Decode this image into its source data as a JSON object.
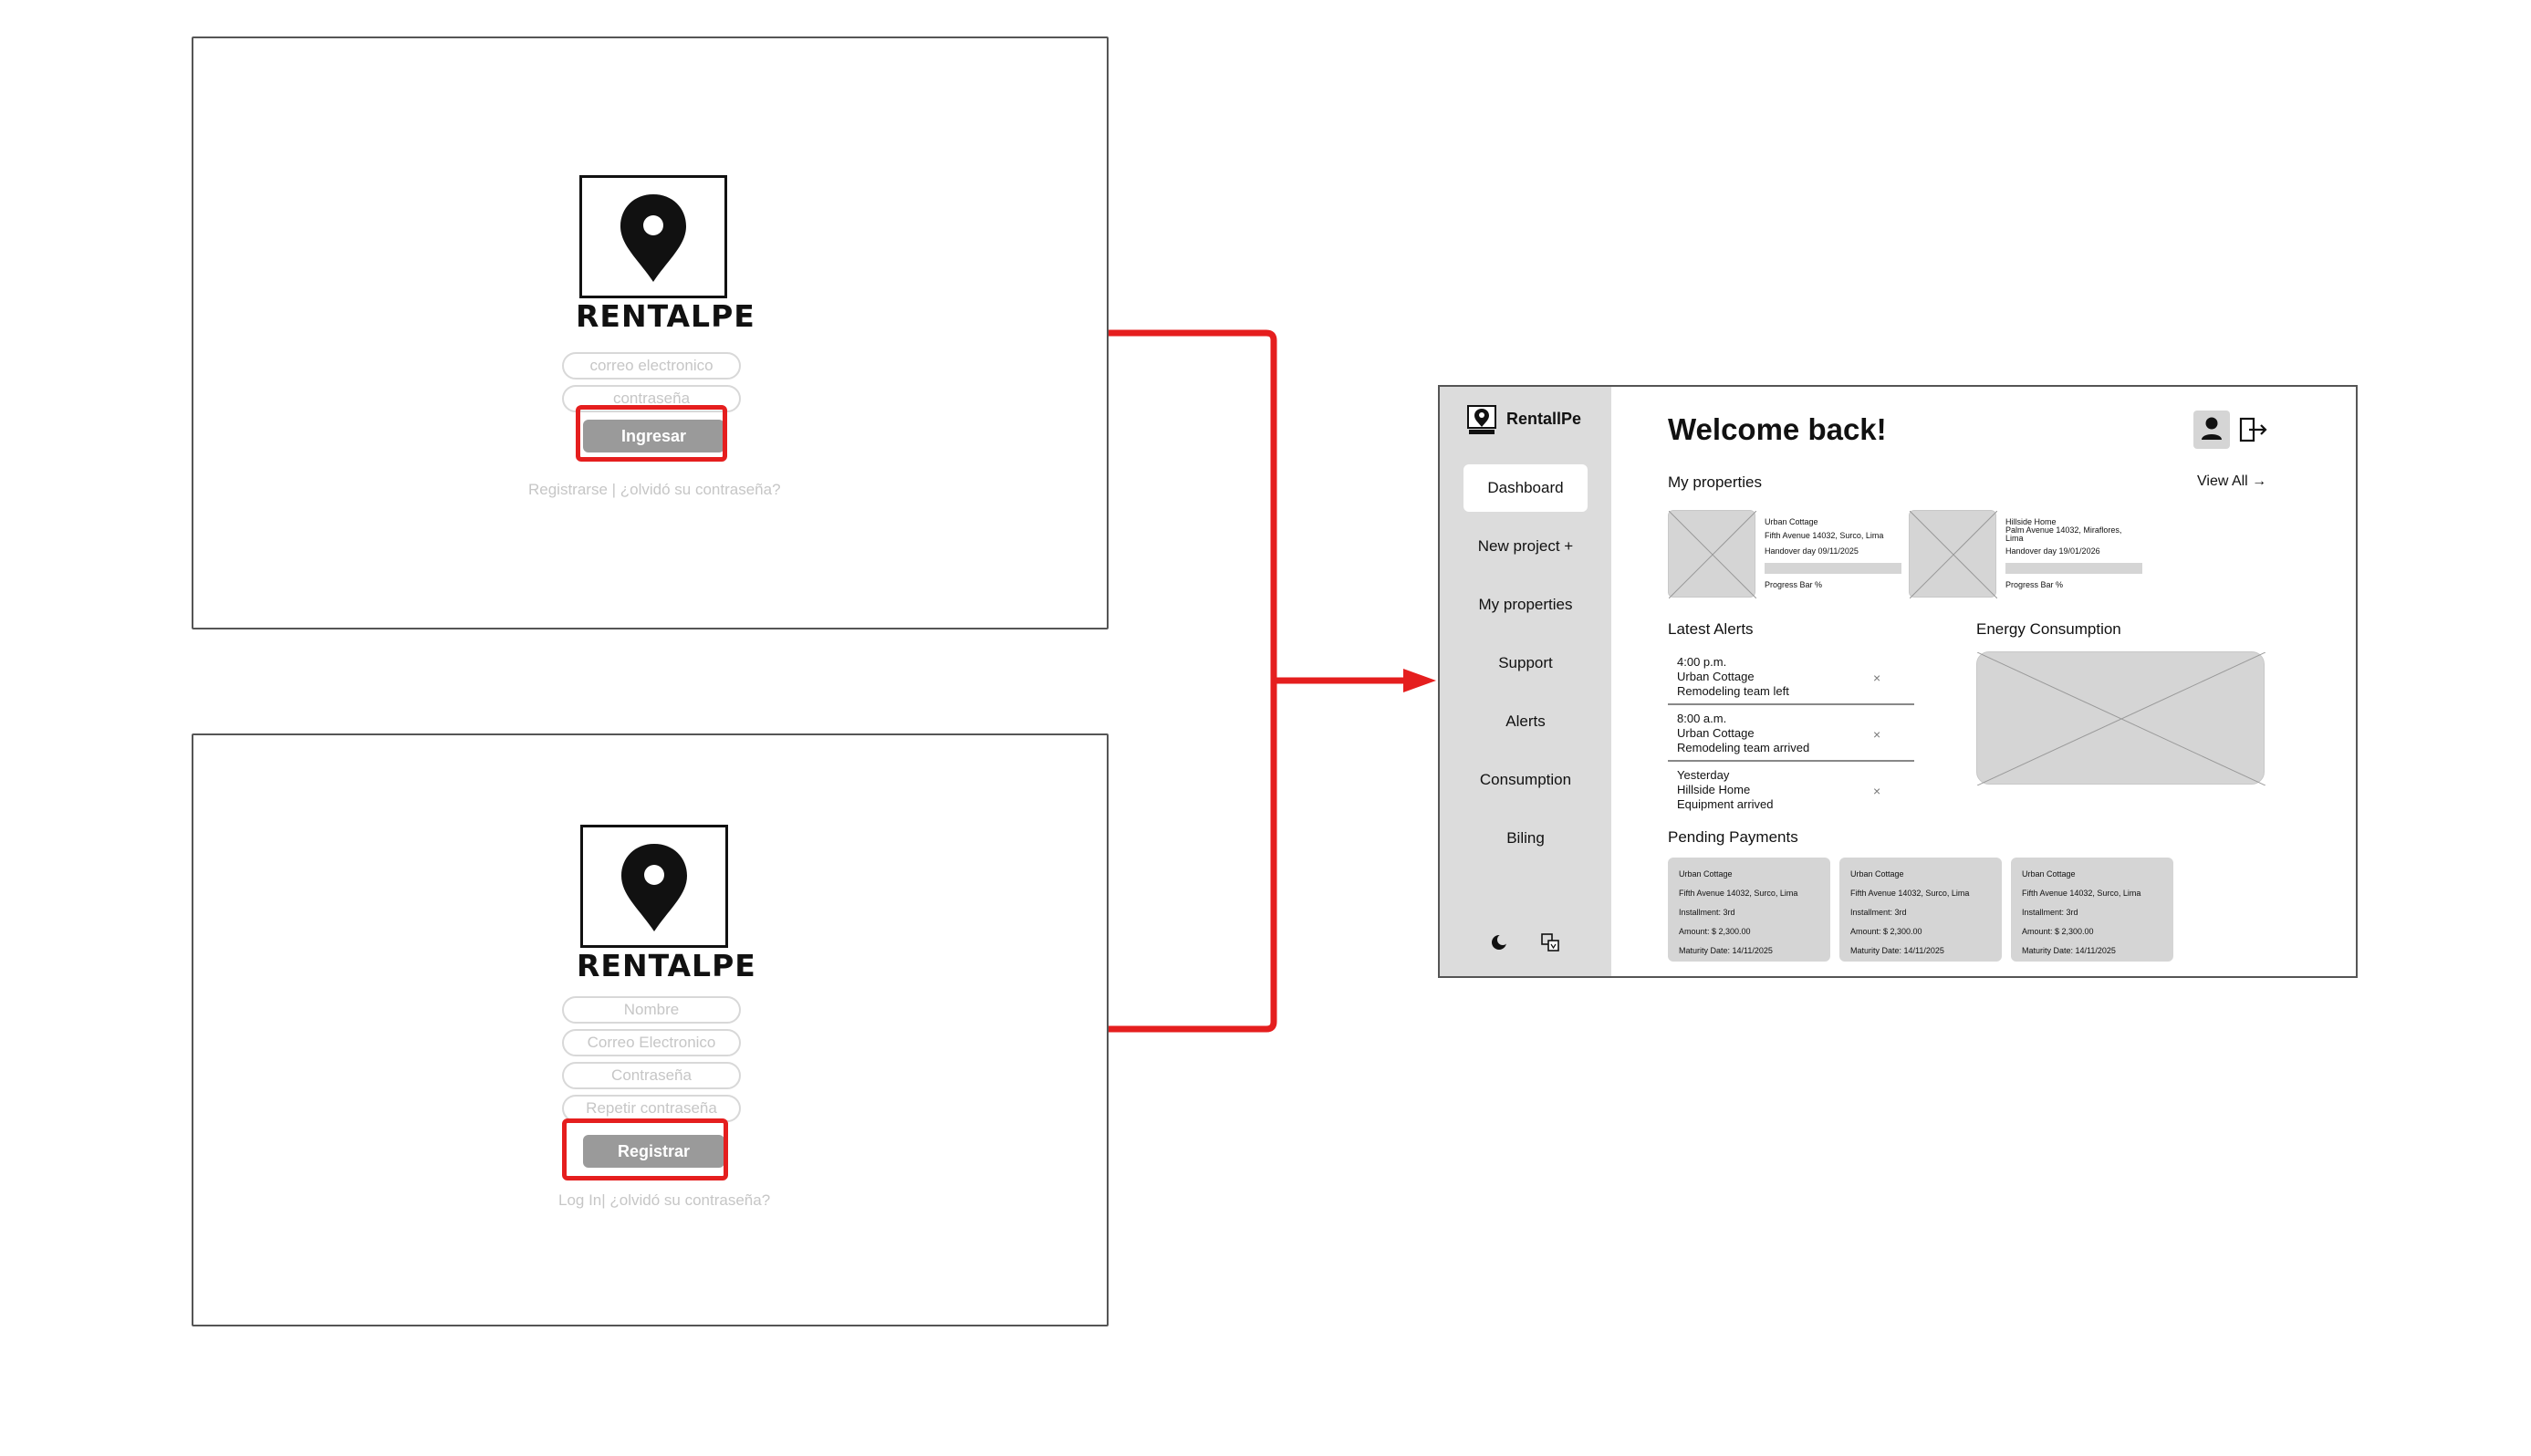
{
  "login": {
    "brand": "RENTALPE",
    "email_placeholder": "correo electronico",
    "password_placeholder": "contraseña",
    "submit_label": "Ingresar",
    "links": "Registrarse | ¿olvidó su contraseña?"
  },
  "register": {
    "brand": "RENTALPE",
    "name_placeholder": "Nombre",
    "email_placeholder": "Correo Electronico",
    "password_placeholder": "Contraseña",
    "repeat_password_placeholder": "Repetir contraseña",
    "submit_label": "Registrar",
    "links": "Log In| ¿olvidó su contraseña?"
  },
  "dashboard": {
    "brand": "RentallPe",
    "nav": [
      "Dashboard",
      "New project +",
      "My properties",
      "Support",
      "Alerts",
      "Consumption",
      "Biling"
    ],
    "active_nav": "Dashboard",
    "welcome": "Welcome back!",
    "my_properties_title": "My properties",
    "view_all": "View All →",
    "properties": [
      {
        "name": "Urban Cottage",
        "address": "Fifth Avenue 14032, Surco, Lima",
        "handover": "Handover day 09/11/2025",
        "progress_label": "Progress Bar %"
      },
      {
        "name": "Hillside Home",
        "address": "Palm Avenue 14032, Miraflores,",
        "address2": "Lima",
        "handover": "Handover day 19/01/2026",
        "progress_label": "Progress Bar %"
      }
    ],
    "alerts_title": "Latest Alerts",
    "alerts": [
      {
        "time": "4:00 p.m.",
        "property": "Urban Cottage",
        "message": "Remodeling team left"
      },
      {
        "time": "8:00 a.m.",
        "property": "Urban Cottage",
        "message": "Remodeling team arrived"
      },
      {
        "time": "Yesterday",
        "property": "Hillside Home",
        "message": "Equipment arrived"
      }
    ],
    "alert_close": "×",
    "energy_title": "Energy Consumption",
    "payments_title": "Pending Payments",
    "payments": [
      {
        "property": "Urban Cottage",
        "address": "Fifth Avenue 14032, Surco, Lima",
        "installment": "Installment: 3rd",
        "amount": "Amount: $ 2,300.00",
        "maturity": "Maturity Date:  14/11/2025"
      },
      {
        "property": "Urban Cottage",
        "address": "Fifth Avenue 14032, Surco, Lima",
        "installment": "Installment: 3rd",
        "amount": "Amount: $ 2,300.00",
        "maturity": "Maturity Date:  14/11/2025"
      },
      {
        "property": "Urban Cottage",
        "address": "Fifth Avenue 14032, Surco, Lima",
        "installment": "Installment: 3rd",
        "amount": "Amount: $ 2,300.00",
        "maturity": "Maturity Date:  14/11/2025"
      }
    ]
  },
  "colors": {
    "connector": "#e51e1e",
    "placeholder_gray": "#d5d5d5",
    "button_gray": "#9a9a9a"
  },
  "icons": [
    "location-pin-icon",
    "user-icon",
    "logout-icon",
    "moon-icon",
    "translate-icon",
    "close-icon"
  ]
}
